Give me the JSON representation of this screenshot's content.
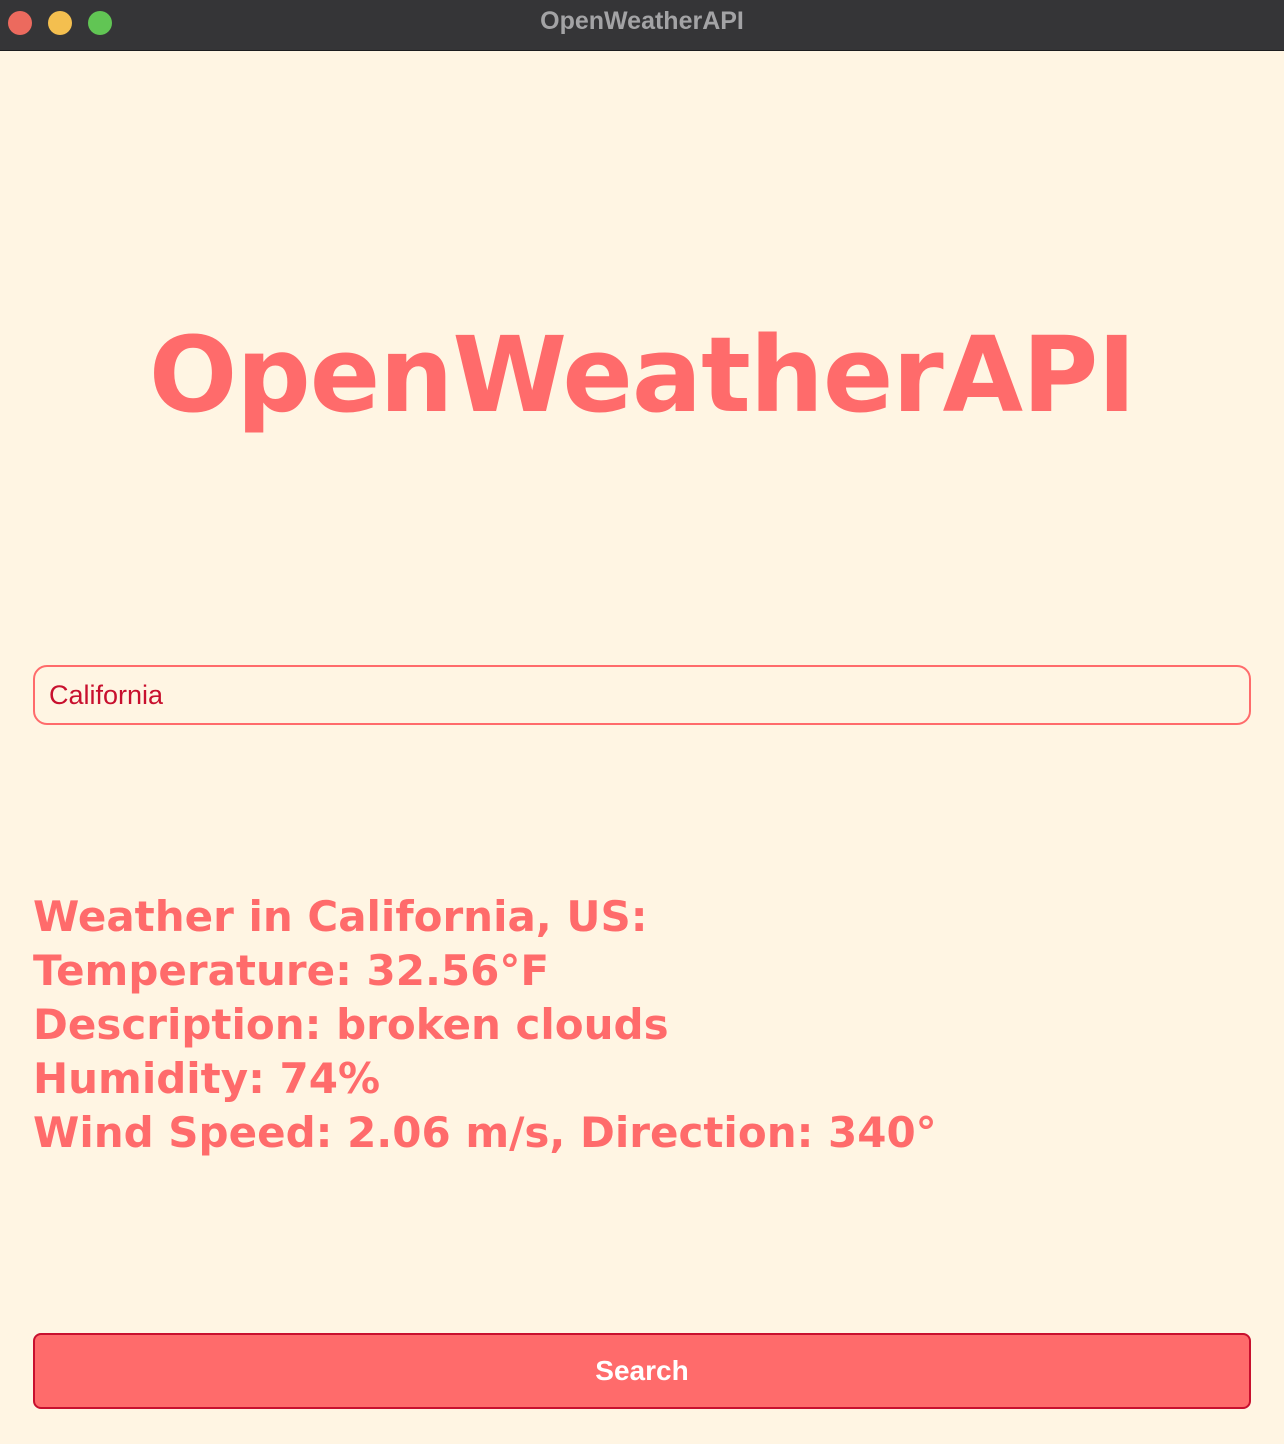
{
  "window": {
    "title": "OpenWeatherAPI"
  },
  "app": {
    "heading": "OpenWeatherAPI"
  },
  "search": {
    "value": "California",
    "button_label": "Search"
  },
  "weather": {
    "location_line": "Weather in California, US:",
    "temperature_line": "Temperature: 32.56°F",
    "description_line": "Description: broken clouds",
    "humidity_line": "Humidity: 74%",
    "wind_line": "Wind Speed: 2.06 m/s, Direction: 340°"
  },
  "colors": {
    "background": "#FFF5E3",
    "accent": "#FF6B6B",
    "input_text": "#C8102E",
    "titlebar": "#353537"
  },
  "icons": {
    "close": "close-icon",
    "minimize": "minimize-icon",
    "zoom": "zoom-icon"
  }
}
